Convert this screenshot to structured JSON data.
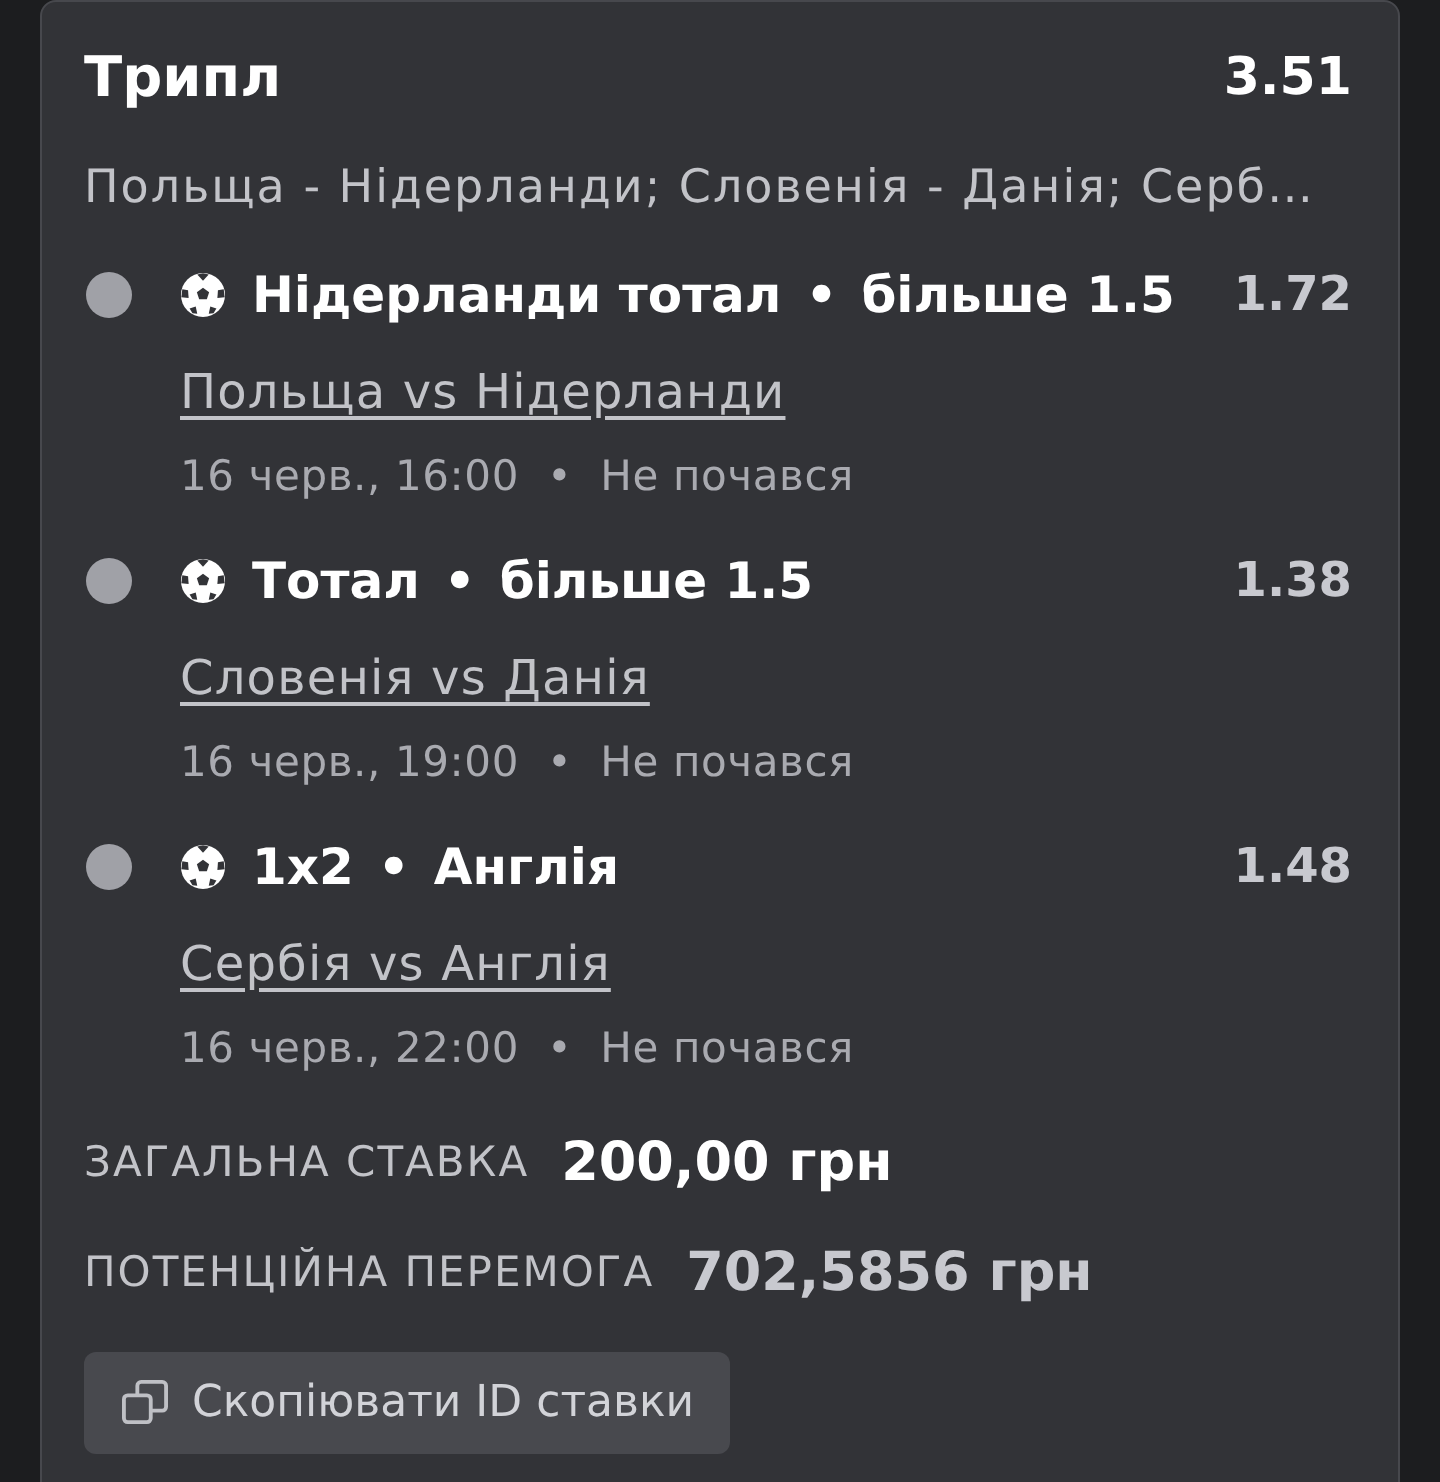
{
  "bet": {
    "title": "Трипл",
    "odds": "3.51",
    "events_summary": "Польща - Нідерланди; Словенія - Данія; Серб…"
  },
  "selections": [
    {
      "color": "#a0a1a7",
      "market": "Нідерланди тотал",
      "separator": "•",
      "pick": "більше 1.5",
      "odds": "1.72",
      "match": "Польща vs Нідерланди",
      "date": "16 черв., 16:00",
      "dot": "•",
      "status": "Не почався"
    },
    {
      "color": "#a0a1a7",
      "market": "Тотал",
      "separator": "•",
      "pick": "більше 1.5",
      "odds": "1.38",
      "match": "Словенія vs Данія",
      "date": "16 черв., 19:00",
      "dot": "•",
      "status": "Не почався"
    },
    {
      "color": "#a0a1a7",
      "market": "1x2",
      "separator": "•",
      "pick": "Англія",
      "odds": "1.48",
      "match": "Сербія vs Англія",
      "date": "16 черв., 22:00",
      "dot": "•",
      "status": "Не почався"
    }
  ],
  "totals": [
    {
      "kind": "stake",
      "label": "ЗАГАЛЬНА СТАВКА",
      "value": "200,00 грн"
    },
    {
      "kind": "win",
      "label": "ПОТЕНЦІЙНА ПЕРЕМОГА",
      "value": "702,5856 грн"
    }
  ],
  "copy_button": {
    "label": "Скопіювати ID ставки"
  }
}
